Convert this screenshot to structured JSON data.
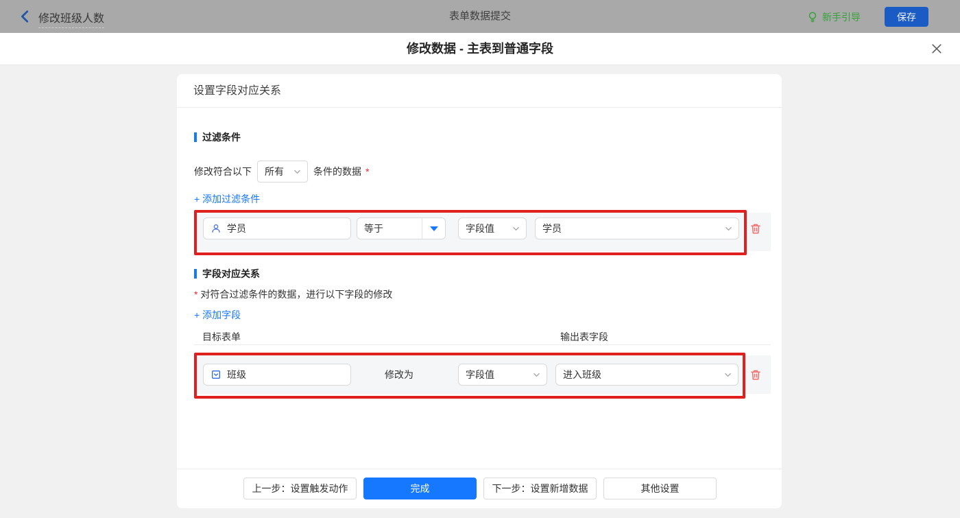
{
  "topbar": {
    "title": "修改班级人数",
    "center_title": "表单数据提交",
    "guide_label": "新手引导",
    "save_label": "保存"
  },
  "modal": {
    "title": "修改数据 - 主表到普通字段"
  },
  "panel": {
    "header": "设置字段对应关系"
  },
  "filter": {
    "section_title": "过滤条件",
    "match_prefix": "修改符合以下",
    "match_value": "所有",
    "match_suffix": "条件的数据",
    "required_mark": "*",
    "add_label": "+ 添加过滤条件",
    "row": {
      "field": "学员",
      "operator": "等于",
      "value_type": "字段值",
      "value": "学员"
    }
  },
  "mapping": {
    "section_title": "字段对应关系",
    "required_mark": "*",
    "note": "对符合过滤条件的数据，进行以下字段的修改",
    "add_label": "+ 添加字段",
    "columns": {
      "target": "目标表单",
      "output": "输出表字段"
    },
    "row": {
      "field": "班级",
      "action_label": "修改为",
      "value_type": "字段值",
      "value": "进入班级"
    }
  },
  "footer": {
    "prev_label": "上一步：设置触发动作",
    "done_label": "完成",
    "next_label": "下一步：设置新增数据",
    "other_label": "其他设置"
  },
  "colors": {
    "topbar_bg": "#a9a9a9",
    "accent_blue": "#1677ff",
    "save_button_blue": "#1a5cc4",
    "guide_green": "#35a23a",
    "annotation_red": "#e01f1f",
    "trash_red": "#f56c6c",
    "row_bg": "#f5f6f7",
    "page_bg": "#f1f1f2",
    "required_red": "#f5222d"
  }
}
